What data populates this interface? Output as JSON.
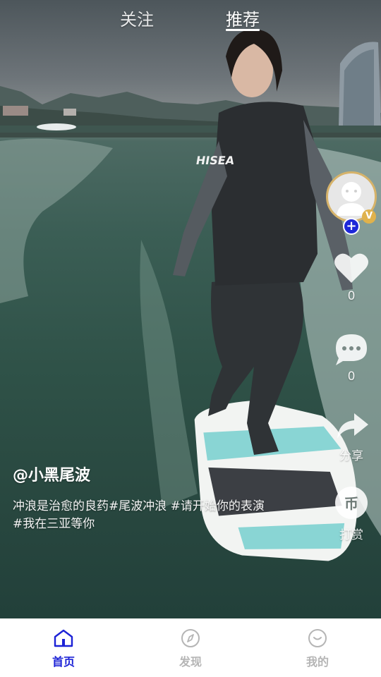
{
  "top_tabs": {
    "follow": "关注",
    "recommend": "推荐",
    "active": "推荐"
  },
  "sidebar": {
    "like_count": "0",
    "comment_count": "0",
    "share_label": "分享",
    "tip_label": "打赏",
    "tip_icon_text": "币",
    "vip_badge": "V",
    "follow_plus": "+"
  },
  "post": {
    "author": "@小黑尾波",
    "caption_line1": "冲浪是治愈的良药#尾波冲浪 #请开始你的表演",
    "caption_line2": "#我在三亚等你"
  },
  "video": {
    "vest_text": "HISEA"
  },
  "tabbar": {
    "items": [
      {
        "label": "首页",
        "active": true
      },
      {
        "label": "发现",
        "active": false
      },
      {
        "label": "我的",
        "active": false
      }
    ]
  },
  "colors": {
    "active_nav": "#1c22d6",
    "inactive_nav": "#b5b5b5",
    "avatar_ring": "#d6b36a",
    "follow_plus": "#1e28d8"
  }
}
